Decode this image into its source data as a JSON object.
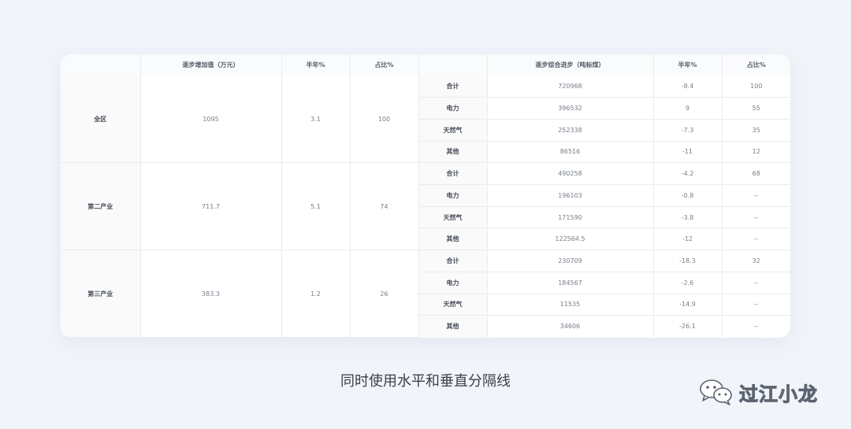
{
  "table": {
    "left_headers": [
      "",
      "逐步增加值（万元）",
      "半年%",
      "占比%"
    ],
    "right_headers": [
      "",
      "逐步综合进步（吨标煤）",
      "半年%",
      "占比%"
    ],
    "groups": [
      {
        "sector": "全区",
        "value": "1095",
        "half_year": "3.1",
        "share": "100",
        "rows": [
          {
            "energy": "合计",
            "amount": "720968",
            "half_year": "-8.4",
            "share": "100"
          },
          {
            "energy": "电力",
            "amount": "396532",
            "half_year": "9",
            "share": "55"
          },
          {
            "energy": "天然气",
            "amount": "252338",
            "half_year": "-7.3",
            "share": "35"
          },
          {
            "energy": "其他",
            "amount": "86516",
            "half_year": "-11",
            "share": "12"
          }
        ]
      },
      {
        "sector": "第二产业",
        "value": "711.7",
        "half_year": "5.1",
        "share": "74",
        "rows": [
          {
            "energy": "合计",
            "amount": "490258",
            "half_year": "-4.2",
            "share": "68"
          },
          {
            "energy": "电力",
            "amount": "196103",
            "half_year": "-0.8",
            "share": "--"
          },
          {
            "energy": "天然气",
            "amount": "171590",
            "half_year": "-3.8",
            "share": "--"
          },
          {
            "energy": "其他",
            "amount": "122564.5",
            "half_year": "-12",
            "share": "--"
          }
        ]
      },
      {
        "sector": "第三产业",
        "value": "383.3",
        "half_year": "1.2",
        "share": "26",
        "rows": [
          {
            "energy": "合计",
            "amount": "230709",
            "half_year": "-18.3",
            "share": "32"
          },
          {
            "energy": "电力",
            "amount": "184567",
            "half_year": "-2.6",
            "share": "--"
          },
          {
            "energy": "天然气",
            "amount": "11535",
            "half_year": "-14.9",
            "share": "--"
          },
          {
            "energy": "其他",
            "amount": "34606",
            "half_year": "-26.1",
            "share": "--"
          }
        ]
      }
    ]
  },
  "caption": "同时使用水平和垂直分隔线",
  "watermark": {
    "icon": "wechat-icon",
    "text": "过江小龙"
  },
  "colors": {
    "background": "#f1f4f9",
    "card": "#ffffff",
    "border": "#e8ebf0",
    "label_cell": "#fafafa"
  }
}
